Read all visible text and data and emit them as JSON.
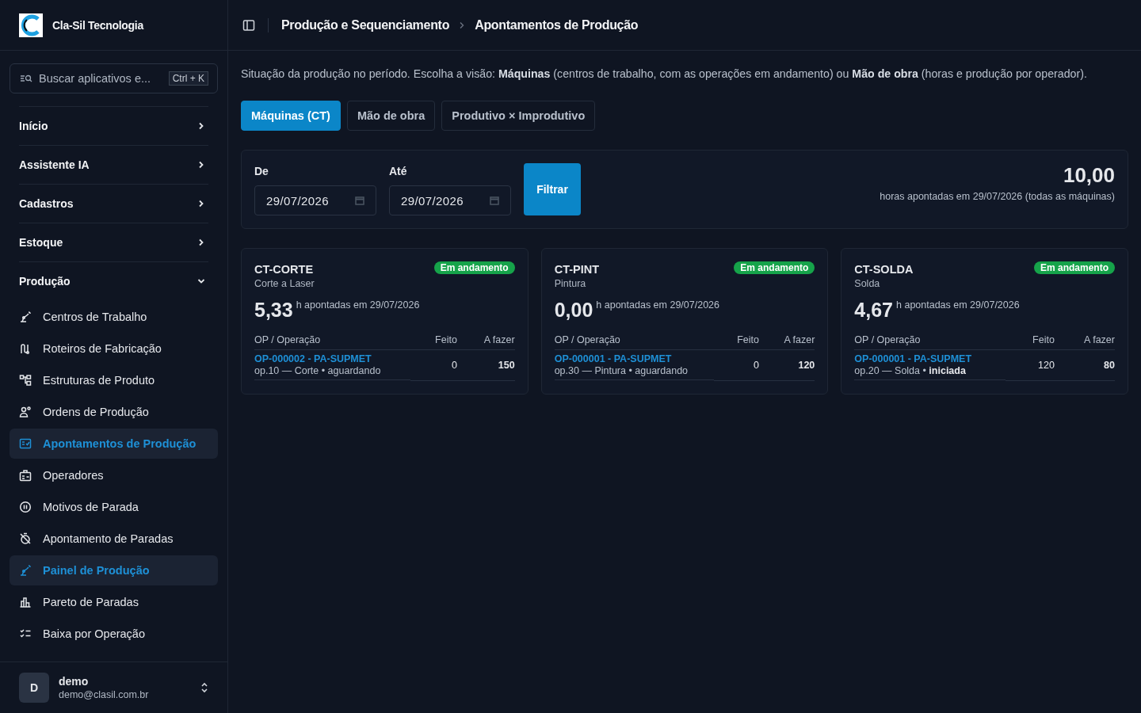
{
  "sidebar": {
    "brand": "Cla-Sil Tecnologia",
    "search": {
      "placeholder": "Buscar aplicativos e...",
      "shortcut": "Ctrl + K"
    },
    "groups": [
      {
        "label": "Início",
        "expanded": false
      },
      {
        "label": "Assistente IA",
        "expanded": false
      },
      {
        "label": "Cadastros",
        "expanded": false
      },
      {
        "label": "Estoque",
        "expanded": false
      },
      {
        "label": "Produção",
        "expanded": true,
        "children": [
          {
            "label": "Centros de Trabalho",
            "selected": false
          },
          {
            "label": "Roteiros de Fabricação",
            "selected": false
          },
          {
            "label": "Estruturas de Produto",
            "selected": false
          },
          {
            "label": "Ordens de Produção",
            "selected": false
          },
          {
            "label": "Apontamentos de Produção",
            "selected": true
          },
          {
            "label": "Operadores",
            "selected": false
          },
          {
            "label": "Motivos de Parada",
            "selected": false
          },
          {
            "label": "Apontamento de Paradas",
            "selected": false
          },
          {
            "label": "Painel de Produção",
            "selected": true
          },
          {
            "label": "Pareto de Paradas",
            "selected": false
          },
          {
            "label": "Baixa por Operação",
            "selected": false
          }
        ]
      }
    ],
    "user": {
      "initial": "D",
      "name": "demo",
      "email": "demo@clasil.com.br"
    }
  },
  "breadcrumb": [
    "Produção e Sequenciamento",
    "Apontamentos de Produção"
  ],
  "description": "Situação da produção no período. Escolha a visão: **Máquinas** (centros de trabalho, com as operações em andamento) ou **Mão de obra** (horas e produção por operador).",
  "tabs": [
    {
      "label": "Máquinas (CT)",
      "selected": true
    },
    {
      "label": "Mão de obra",
      "selected": false
    },
    {
      "label": "Produtivo × Improdutivo",
      "selected": false
    }
  ],
  "filter": {
    "from_label": "De",
    "from": "29/07/2026",
    "to_label": "Até",
    "to": "29/07/2026",
    "button": "Filtrar",
    "total": "10,00",
    "total_caption": "horas apontadas em 29/07/2026 (todas as máquinas)"
  },
  "machines": [
    {
      "code": "CT-CORTE",
      "name": "Corte a Laser",
      "status": {
        "label": "Em andamento",
        "kind": "running"
      },
      "hours": "5,33",
      "hours_caption": "h apontadas em 29/07/2026",
      "columns": [
        "OP / Operação",
        "Feito",
        "A fazer"
      ],
      "rows": [
        {
          "order": "OP-000002 - PA-SUPMET",
          "operation": "op.10 — Corte • aguardando",
          "done": "0",
          "todo": "150"
        }
      ]
    },
    {
      "code": "CT-PINT",
      "name": "Pintura",
      "status": {
        "label": "Em andamento",
        "kind": "running"
      },
      "hours": "0,00",
      "hours_caption": "h apontadas em 29/07/2026",
      "columns": [
        "OP / Operação",
        "Feito",
        "A fazer"
      ],
      "rows": [
        {
          "order": "OP-000001 - PA-SUPMET",
          "operation": "op.30 — Pintura • aguardando",
          "done": "0",
          "todo": "120"
        }
      ]
    },
    {
      "code": "CT-SOLDA",
      "name": "Solda",
      "status": {
        "label": "Em andamento",
        "kind": "running"
      },
      "hours": "4,67",
      "hours_caption": "h apontadas em 29/07/2026",
      "columns": [
        "OP / Operação",
        "Feito",
        "A fazer"
      ],
      "rows": [
        {
          "order": "OP-000001 - PA-SUPMET",
          "operation": "op.20 — Solda • **iniciada**",
          "done": "120",
          "todo": "80"
        }
      ]
    }
  ]
}
